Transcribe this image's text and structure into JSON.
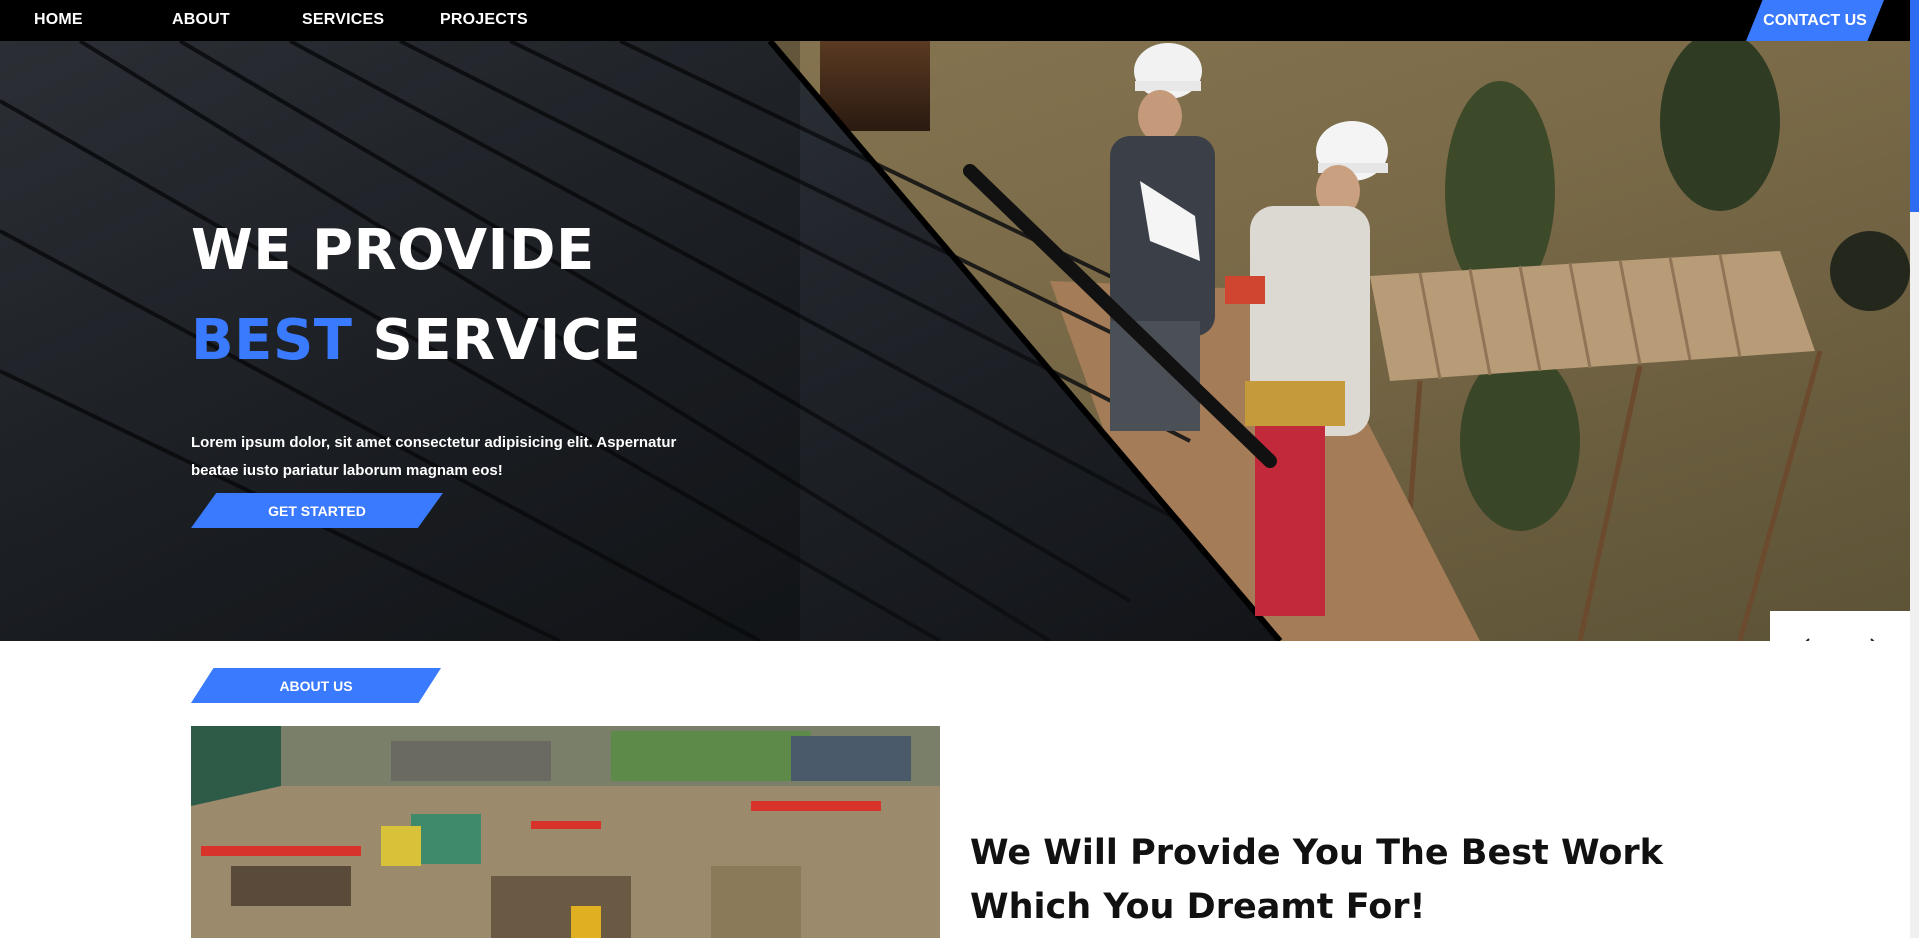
{
  "nav": {
    "home": "HOME",
    "about": "ABOUT",
    "services": "SERVICES",
    "projects": "PROJECTS",
    "contact": "CONTACT US"
  },
  "hero": {
    "title_line1": "WE PROVIDE",
    "title_accent": "BEST",
    "title_line2_rest": "SERVICE",
    "description": "Lorem ipsum dolor, sit amet consectetur adipisicing elit. Aspernatur beatae iusto pariatur laborum magnam eos!",
    "cta_label": "GET STARTED"
  },
  "slider": {
    "prev_icon": "chevron-left-icon",
    "next_icon": "chevron-right-icon"
  },
  "about": {
    "badge": "ABOUT US",
    "heading": "We Will Provide You The Best Work Which You Dreamt For!"
  },
  "colors": {
    "accent": "#3a7afe",
    "nav_bg": "#000000",
    "text_dark": "#111111"
  }
}
